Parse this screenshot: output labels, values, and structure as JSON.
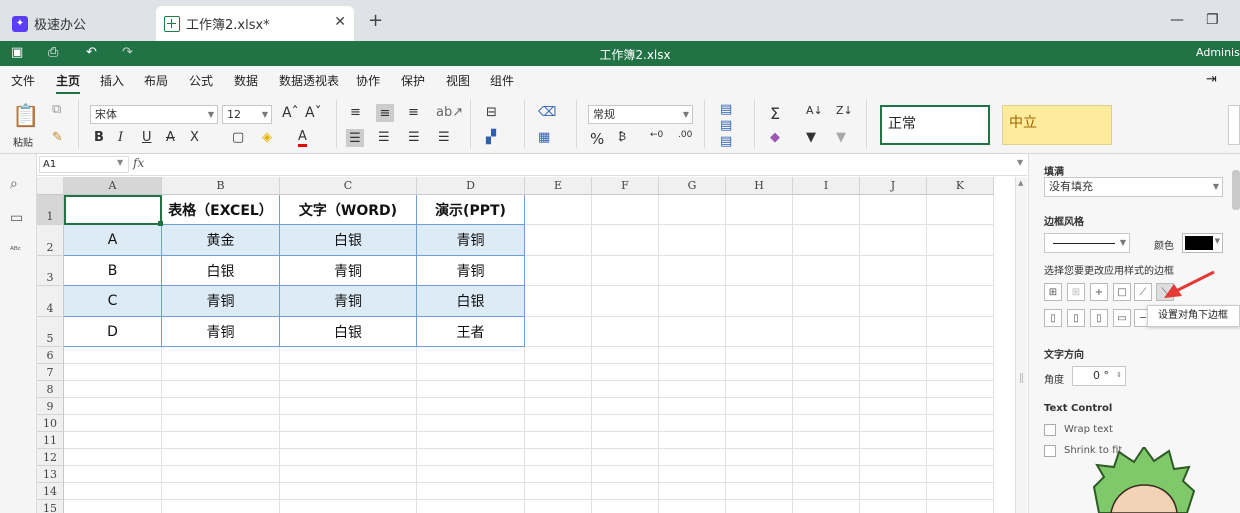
{
  "tabs": [
    {
      "label": "极速办公"
    },
    {
      "label": "工作簿2.xlsx*"
    }
  ],
  "titlebar": {
    "doc_title": "工作簿2.xlsx",
    "user": "Administ"
  },
  "menu": [
    "文件",
    "主页",
    "插入",
    "布局",
    "公式",
    "数据",
    "数据透视表",
    "协作",
    "保护",
    "视图",
    "组件"
  ],
  "active_menu": "主页",
  "ribbon": {
    "paste_label": "粘贴",
    "font_name": "宋体",
    "font_size": "12",
    "number_format": "常规",
    "style_normal": "正常",
    "style_neutral": "中立",
    "bold": "B",
    "italic": "I",
    "underline": "U",
    "strike": "A",
    "sub": "X",
    "fontcolor": "A",
    "percent": "%"
  },
  "formula_bar": {
    "cell_ref": "A1",
    "fx": "fx"
  },
  "sheet": {
    "columns": [
      "A",
      "B",
      "C",
      "D",
      "E",
      "F",
      "G",
      "H",
      "I",
      "J",
      "K"
    ],
    "rows": [
      "1",
      "2",
      "3",
      "4",
      "5",
      "6",
      "7",
      "8",
      "9",
      "10",
      "11",
      "12",
      "13",
      "14",
      "15"
    ],
    "table": [
      [
        "",
        "表格（EXCEL）",
        "文字（WORD)",
        "演示(PPT)"
      ],
      [
        "A",
        "黄金",
        "白银",
        "青铜"
      ],
      [
        "B",
        "白银",
        "青铜",
        "青铜"
      ],
      [
        "C",
        "青铜",
        "青铜",
        "白银"
      ],
      [
        "D",
        "青铜",
        "白银",
        "王者"
      ]
    ]
  },
  "panel": {
    "fill_label": "填满",
    "fill_value": "没有填充",
    "border_style_label": "边框风格",
    "color_label": "颜色",
    "choose_border_label": "选择您要更改应用样式的边框",
    "tooltip": "设置对角下边框",
    "text_dir_label": "文字方向",
    "angle_label": "角度",
    "angle_value": "0 °",
    "text_control_label": "Text Control",
    "wrap_text": "Wrap text",
    "shrink_to_fit": "Shrink to fit",
    "border_color": "#000000"
  },
  "colors": {
    "brand_green": "#217346",
    "arrow_red": "#e53935",
    "band_blue": "#ddebf7",
    "neutral_fill": "#ffeb9c"
  }
}
